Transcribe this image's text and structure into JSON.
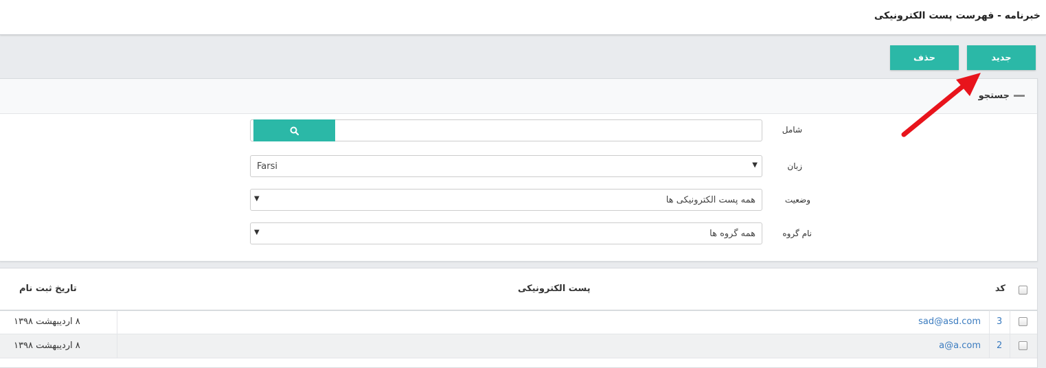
{
  "header": {
    "title": "خبرنامه - فهرست پست الکترونیکی"
  },
  "toolbar": {
    "new_label": "جدید",
    "delete_label": "حذف"
  },
  "search": {
    "title": "جستجو",
    "contains_label": "شامل",
    "contains_value": "",
    "language_label": "زبان",
    "language_value": "Farsi",
    "status_label": "وضعیت",
    "status_value": "همه پست الکترونیکی ها",
    "group_label": "نام گروه",
    "group_value": "همه گروه ها"
  },
  "table": {
    "columns": {
      "code": "کد",
      "email": "پست الکترونیکی",
      "date": "تاریخ ثبت نام"
    },
    "rows": [
      {
        "code": "3",
        "email": "sad@asd.com",
        "date": "۸ اردیبهشت ۱۳۹۸"
      },
      {
        "code": "2",
        "email": "a@a.com",
        "date": "۸ اردیبهشت ۱۳۹۸"
      }
    ]
  },
  "colors": {
    "accent": "#2bb8a7",
    "link": "#3a7bbf",
    "arrow": "#e8141c"
  }
}
